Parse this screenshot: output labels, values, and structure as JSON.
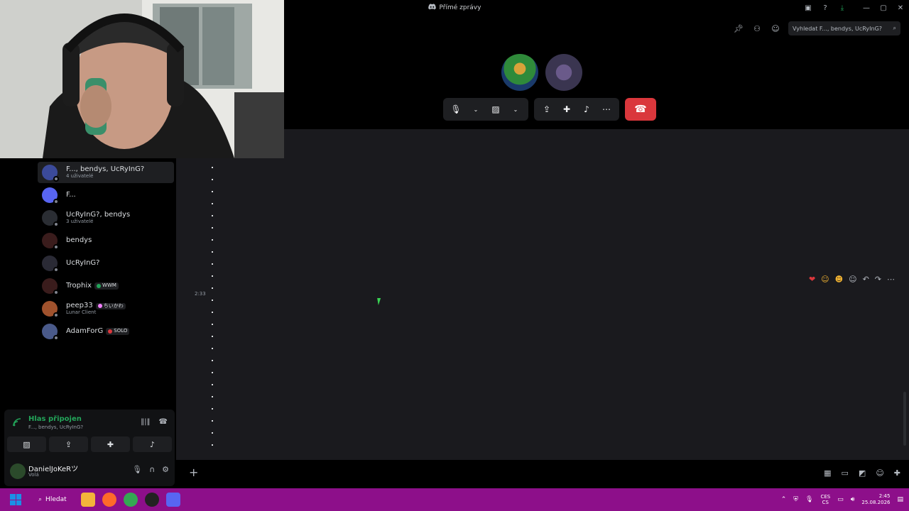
{
  "window": {
    "title": "Přímé zprávy"
  },
  "search": {
    "placeholder": "Vyhledat F..., bendys, UcRyInG?"
  },
  "dm_list": [
    {
      "name": "F..., bendys, UcRyInG?",
      "sub": "4 uživatelé",
      "active": true,
      "avatar_color": "#3b4a9a"
    },
    {
      "name": "F...",
      "sub": "",
      "active": false,
      "avatar_color": "#5865f2"
    },
    {
      "name": "UcRyInG?, bendys",
      "sub": "3 uživatelé",
      "active": false,
      "avatar_color": "#2a2d33"
    },
    {
      "name": "bendys",
      "sub": "",
      "active": false,
      "avatar_color": "#3a1c1c"
    },
    {
      "name": "UcRyInG?",
      "sub": "",
      "active": false,
      "avatar_color": "#2a2a35"
    },
    {
      "name": "Trophix",
      "sub": "",
      "active": false,
      "avatar_color": "#3a1c1c",
      "tag": "WWM",
      "tag_color": "#23a55a"
    },
    {
      "name": "peep33",
      "sub": "Lunar Client",
      "active": false,
      "avatar_color": "#a0522d",
      "tag": "ちいかわ",
      "tag_color": "#f47fff"
    },
    {
      "name": "AdamForG",
      "sub": "",
      "active": false,
      "avatar_color": "#4a5a8a",
      "tag": "SOLO",
      "tag_color": "#da373c"
    }
  ],
  "voice": {
    "status": "Hlas připojen",
    "channel": "F..., bendys, UcRyInG?"
  },
  "user": {
    "name": "DanielJoKeRツ",
    "status": "Volá"
  },
  "chat": {
    "timestamp": "2:33"
  },
  "taskbar": {
    "search_label": "Hledat",
    "lang_top": "CES",
    "lang_bottom": "CS",
    "time": "2:45",
    "date": "25.08.2026"
  },
  "colors": {
    "hangup": "#da373c",
    "connected": "#23a55a",
    "taskbar": "#8d0f8a"
  }
}
